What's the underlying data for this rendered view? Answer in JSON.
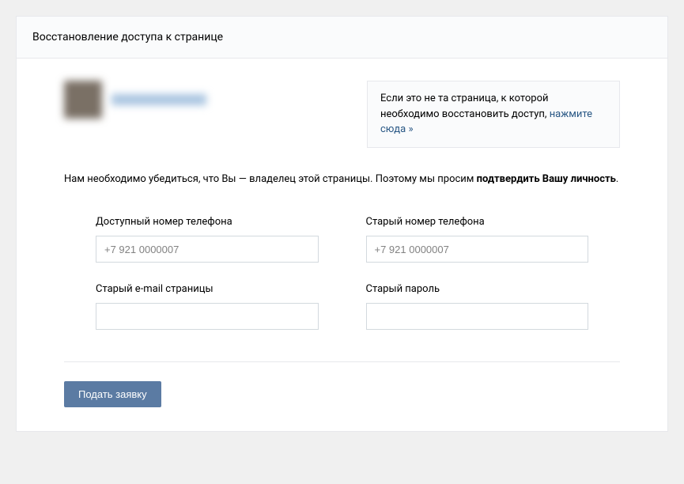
{
  "header": {
    "title": "Восстановление доступа к странице"
  },
  "notice": {
    "text_before": "Если это не та страница, к которой необходимо восстановить доступ, ",
    "link_text": "нажмите сюда »"
  },
  "description": {
    "text_before": "Нам необходимо убедиться, что Вы — владелец этой страницы. Поэтому мы просим ",
    "bold_text": "подтвердить Вашу личность",
    "text_after": "."
  },
  "form": {
    "available_phone": {
      "label": "Доступный номер телефона",
      "placeholder": "+7 921 0000007",
      "value": ""
    },
    "old_phone": {
      "label": "Старый номер телефона",
      "placeholder": "+7 921 0000007",
      "value": ""
    },
    "old_email": {
      "label": "Старый e-mail страницы",
      "placeholder": "",
      "value": ""
    },
    "old_password": {
      "label": "Старый пароль",
      "placeholder": "",
      "value": ""
    }
  },
  "submit": {
    "label": "Подать заявку"
  }
}
